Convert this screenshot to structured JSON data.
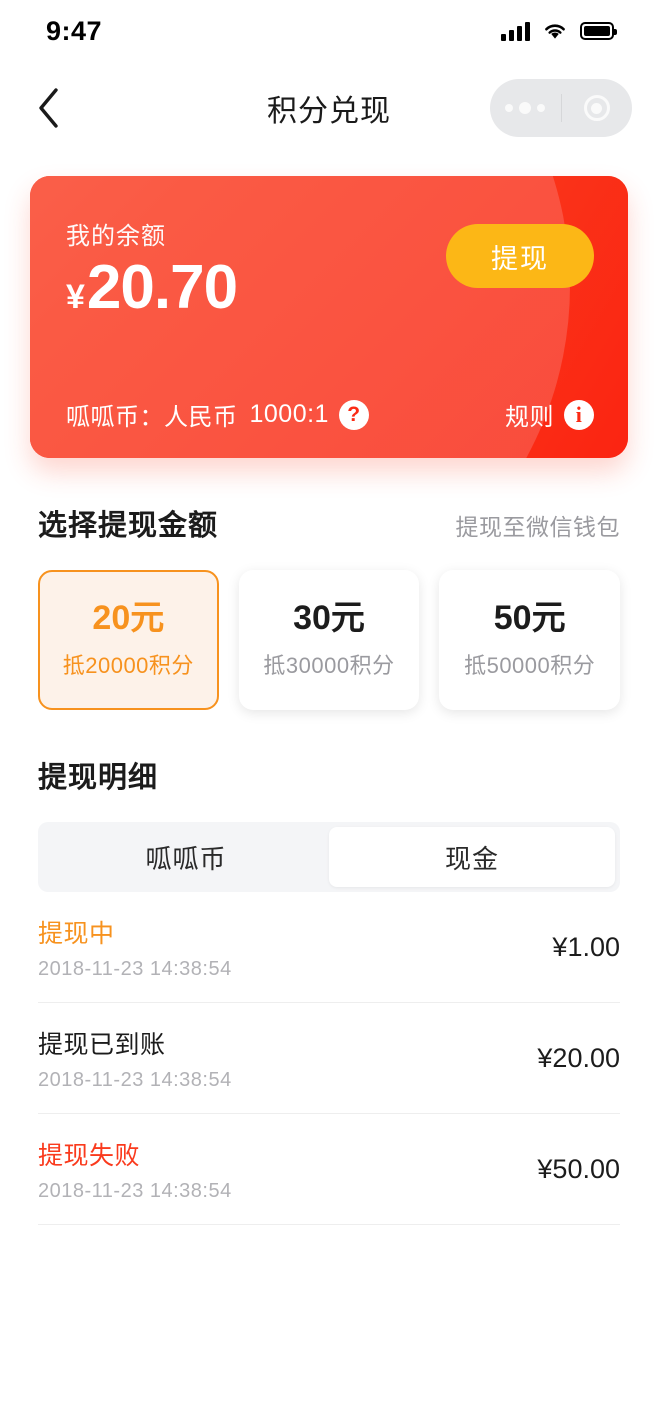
{
  "status_bar": {
    "time": "9:47",
    "signal_icon": "signal-bars-icon",
    "wifi_icon": "wifi-icon",
    "battery_icon": "battery-full-icon"
  },
  "nav": {
    "back_icon": "chevron-left-icon",
    "title": "积分兑现",
    "capsule": {
      "menu_icon": "more-dots-icon",
      "target_icon": "target-circle-icon"
    }
  },
  "balance_card": {
    "label": "我的余额",
    "currency_symbol": "¥",
    "amount": "20.70",
    "withdraw_button": "提现",
    "rate_label": "呱呱币：人民币",
    "rate_value": "1000:1",
    "rate_help_icon": "question-mark-icon",
    "rules_label": "规则",
    "rules_icon": "info-icon",
    "colors": {
      "gradient_light": "#fb6a55",
      "gradient_dark": "#fb2411",
      "button": "#fcb716"
    }
  },
  "amount_section": {
    "title": "选择提现金额",
    "aside": "提现至微信钱包",
    "options": [
      {
        "amount": "20",
        "unit": "元",
        "sub": "抵20000积分",
        "selected": true
      },
      {
        "amount": "30",
        "unit": "元",
        "sub": "抵30000积分",
        "selected": false
      },
      {
        "amount": "50",
        "unit": "元",
        "sub": "抵50000积分",
        "selected": false
      }
    ],
    "selected_color": "#f7921e"
  },
  "detail_section": {
    "title": "提现明细",
    "tabs": [
      {
        "label": "呱呱币",
        "active": false
      },
      {
        "label": "现金",
        "active": true
      }
    ],
    "transactions": [
      {
        "status": "提现中",
        "state": "pending",
        "date": "2018-11-23 14:38:54",
        "amount": "¥1.00"
      },
      {
        "status": "提现已到账",
        "state": "done",
        "date": "2018-11-23 14:38:54",
        "amount": "¥20.00"
      },
      {
        "status": "提现失败",
        "state": "failed",
        "date": "2018-11-23 14:38:54",
        "amount": "¥50.00"
      }
    ],
    "status_colors": {
      "pending": "#f7921e",
      "done": "#1c1c1c",
      "failed": "#fa3a1d"
    }
  }
}
